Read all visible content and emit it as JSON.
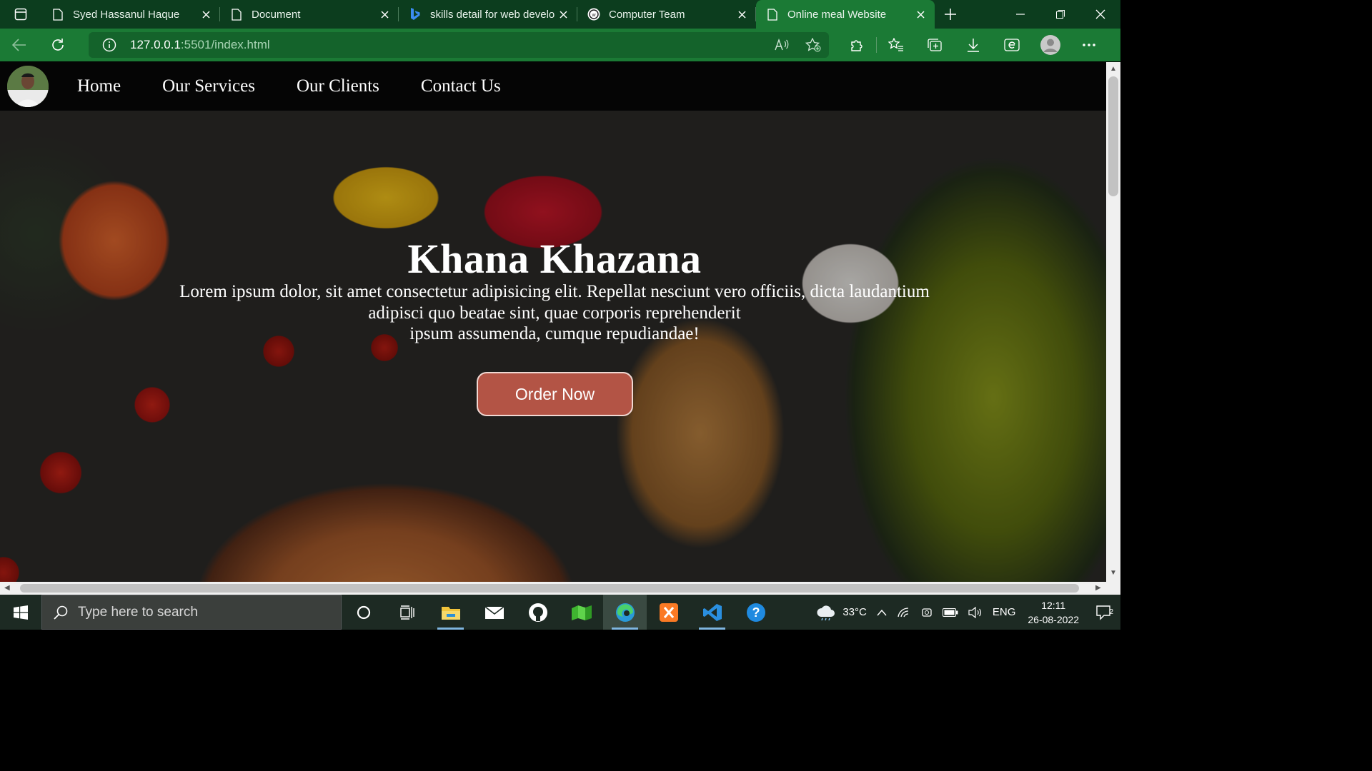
{
  "browser": {
    "tabs": [
      {
        "title": "Syed Hassanul Haque",
        "favicon": "page-icon",
        "active": false
      },
      {
        "title": "Document",
        "favicon": "page-icon",
        "active": false
      },
      {
        "title": "skills detail for web develo",
        "favicon": "bing-icon",
        "active": false
      },
      {
        "title": "Computer Team",
        "favicon": "cloudfront-icon",
        "active": false
      },
      {
        "title": "Online meal Website",
        "favicon": "page-icon",
        "active": true
      }
    ],
    "url_host": "127.0.0.1",
    "url_path": ":5501/index.html"
  },
  "site": {
    "nav": {
      "links": [
        "Home",
        "Our Services",
        "Our Clients",
        "Contact Us"
      ]
    },
    "hero": {
      "title": "Khana Khazana",
      "description_line1": "Lorem ipsum dolor, sit amet consectetur adipisicing elit. Repellat nesciunt vero officiis, dicta laudantium",
      "description_line2": "adipisci quo beatae sint, quae corporis reprehenderit",
      "description_line3": "ipsum assumenda, cumque repudiandae!",
      "button_label": "Order Now"
    }
  },
  "taskbar": {
    "search_placeholder": "Type here to search",
    "weather": "33°C",
    "language": "ENG",
    "time": "12:11",
    "date": "26-08-2022",
    "notifications": "2"
  },
  "colors": {
    "browser_frame": "#0c3d1e",
    "browser_toolbar": "#1b7a35",
    "order_button": "#b35445"
  }
}
